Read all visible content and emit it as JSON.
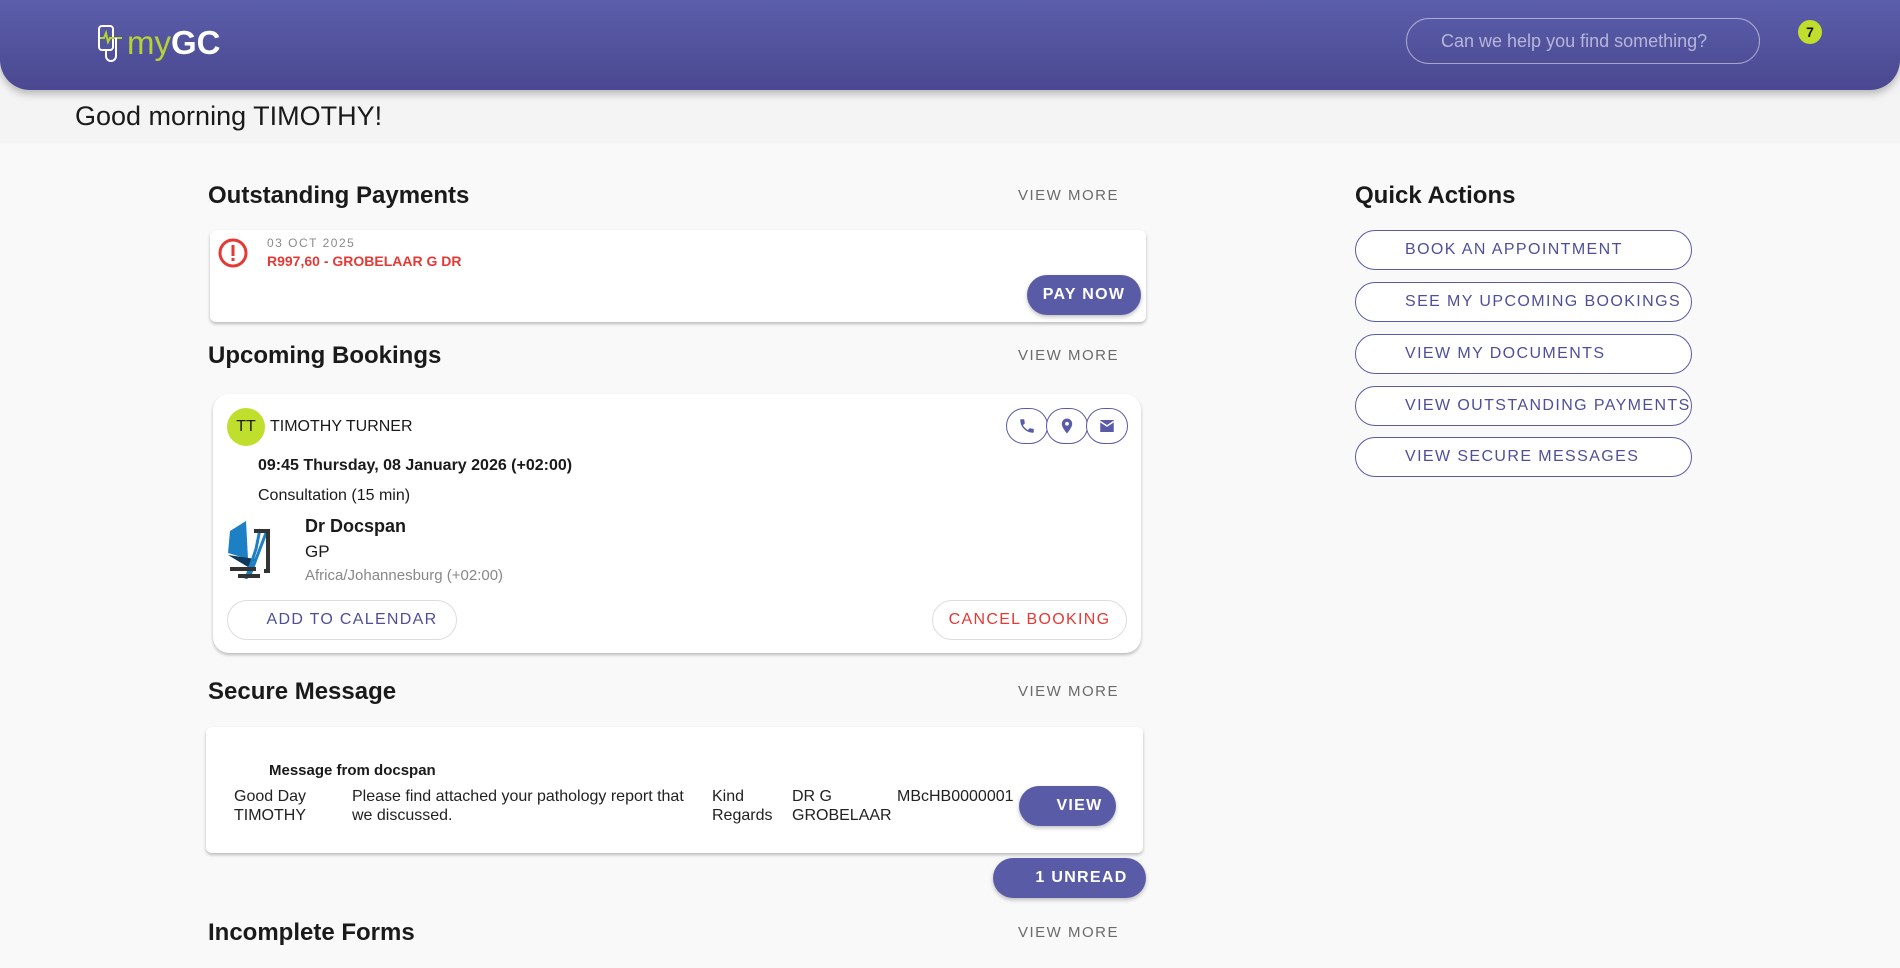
{
  "header": {
    "logo_my": "my",
    "logo_gc": "GC",
    "search_placeholder": "Can we help you find something?",
    "notification_count": "7"
  },
  "greeting": "Good morning  TIMOTHY!",
  "outstanding": {
    "title": "Outstanding Payments",
    "view_more": "VIEW MORE",
    "items": [
      {
        "date": "03 OCT 2025",
        "description": "R997,60 - GROBELAAR G DR",
        "pay_label": "PAY NOW"
      }
    ]
  },
  "bookings": {
    "title": "Upcoming Bookings",
    "view_more": "VIEW MORE",
    "items": [
      {
        "initials": "TT",
        "patient": "TIMOTHY TURNER",
        "datetime": "09:45 Thursday, 08 January 2026 (+02:00)",
        "type": "Consultation (15 min)",
        "doctor": "Dr Docspan",
        "specialty": "GP",
        "timezone": "Africa/Johannesburg (+02:00)",
        "add_calendar": "ADD TO CALENDAR",
        "cancel": "CANCEL BOOKING"
      }
    ]
  },
  "messages": {
    "title": "Secure Message",
    "view_more": "VIEW MORE",
    "items": [
      {
        "subject": "Message from docspan",
        "greeting": "Good Day TIMOTHY",
        "body": "Please find attached your pathology report that we discussed.",
        "closing": "Kind Regards",
        "sender": "DR G GROBELAAR",
        "ref": "MBcHB0000001",
        "view": "VIEW"
      }
    ],
    "unread": "1 UNREAD"
  },
  "forms": {
    "title": "Incomplete Forms",
    "view_more": "VIEW MORE"
  },
  "quick_actions": {
    "title": "Quick Actions",
    "items": [
      "BOOK AN APPOINTMENT",
      "SEE MY UPCOMING BOOKINGS",
      "VIEW MY DOCUMENTS",
      "VIEW OUTSTANDING PAYMENTS",
      "VIEW SECURE MESSAGES"
    ]
  },
  "colors": {
    "primary": "#5a5ba7",
    "accent": "#c0de2c",
    "danger": "#e53935"
  }
}
